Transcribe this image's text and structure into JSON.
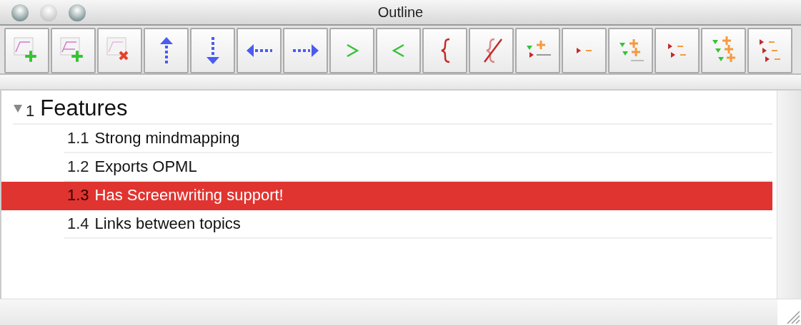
{
  "window": {
    "title": "Outline"
  },
  "toolbar": [
    {
      "kind": "add-child"
    },
    {
      "kind": "add-sibling"
    },
    {
      "kind": "delete"
    },
    {
      "kind": "move-up"
    },
    {
      "kind": "move-down"
    },
    {
      "kind": "outdent"
    },
    {
      "kind": "indent"
    },
    {
      "kind": "greater"
    },
    {
      "kind": "less"
    },
    {
      "kind": "brace"
    },
    {
      "kind": "no-brace"
    },
    {
      "kind": "expand-one"
    },
    {
      "kind": "collapse-one"
    },
    {
      "kind": "expand-two"
    },
    {
      "kind": "collapse-two"
    },
    {
      "kind": "expand-all"
    },
    {
      "kind": "collapse-all"
    }
  ],
  "outline": [
    {
      "number": "1",
      "label": "Features",
      "expanded": true,
      "selected": false,
      "children": [
        {
          "number": "1.1",
          "label": "Strong mindmapping",
          "selected": false
        },
        {
          "number": "1.2",
          "label": "Exports OPML",
          "selected": false
        },
        {
          "number": "1.3",
          "label": "Has Screenwriting support!",
          "selected": true
        },
        {
          "number": "1.4",
          "label": "Links between topics",
          "selected": false
        }
      ]
    }
  ]
}
